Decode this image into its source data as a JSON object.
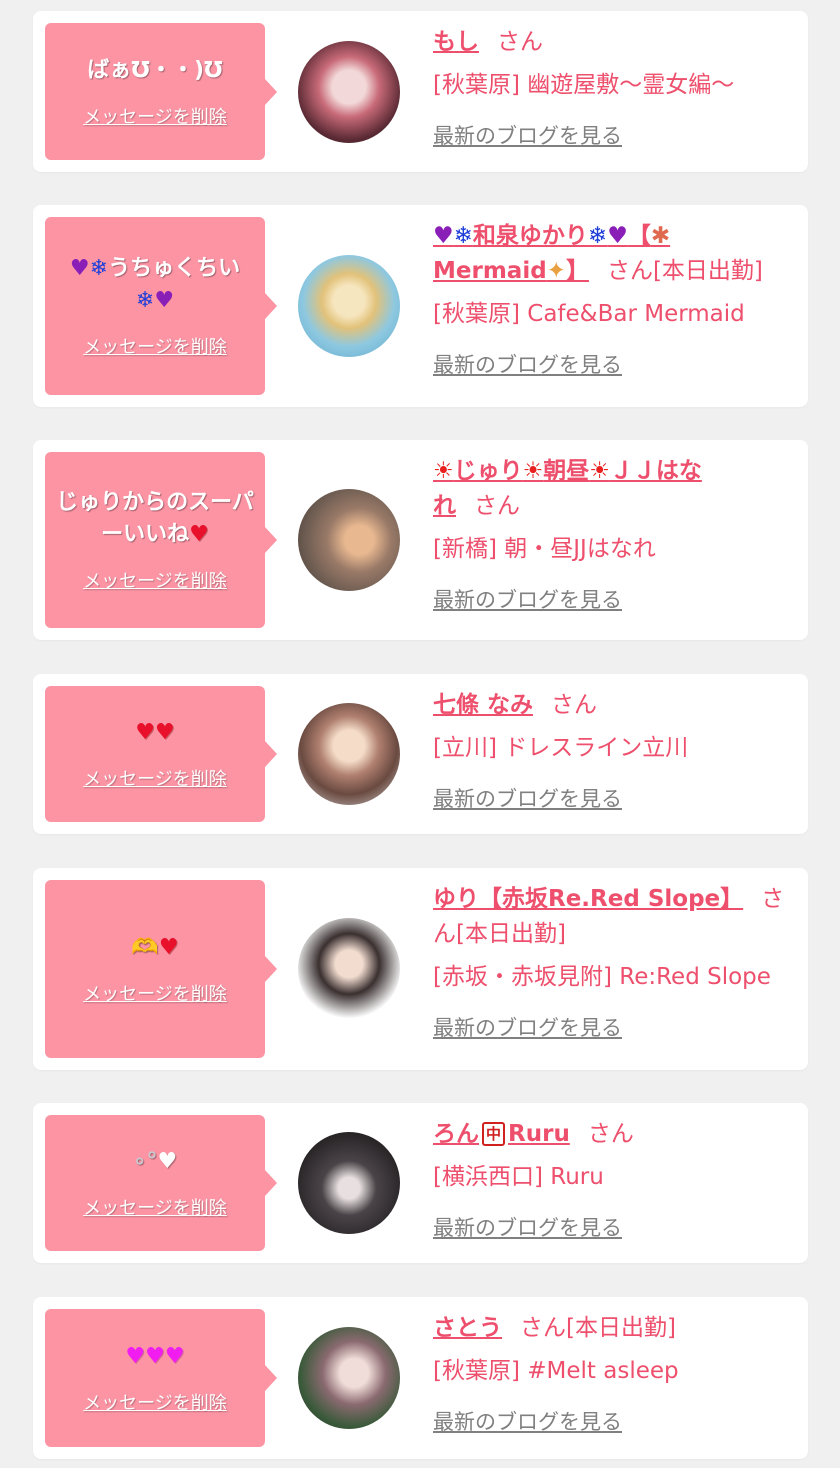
{
  "cards": [
    {
      "message": "ばぁ℧・・)℧",
      "delete_label": "メッセージを削除",
      "name": "もし",
      "honorific": "さん",
      "status": "",
      "shop": "[秋葉原] 幽遊屋敷〜霊女編〜",
      "blog_label": "最新のブログを見る"
    },
    {
      "message": "うちゅくちい",
      "delete_label": "メッセージを削除",
      "name": "和泉ゆかり",
      "name_suffix": "【",
      "name_line2": "Mermaid",
      "name_line2_suffix": "】",
      "honorific": "さん",
      "status": "[本日出勤]",
      "shop": "[秋葉原] Cafe&Bar Mermaid",
      "blog_label": "最新のブログを見る"
    },
    {
      "message": "じゅりからのスーパーいいね",
      "delete_label": "メッセージを削除",
      "name_parts": [
        "じゅり",
        "朝昼",
        "ＪＪはな"
      ],
      "name_line2": "れ",
      "honorific": "さん",
      "status": "",
      "shop": "[新橋] 朝・昼JJはなれ",
      "blog_label": "最新のブログを見る"
    },
    {
      "message": "",
      "delete_label": "メッセージを削除",
      "name": "七條 なみ",
      "honorific": "さん",
      "status": "",
      "shop": "[立川] ドレスライン立川",
      "blog_label": "最新のブログを見る"
    },
    {
      "message": "",
      "delete_label": "メッセージを削除",
      "name": "ゆり【赤坂Re.Red Slope】",
      "honorific": "さ",
      "honorific_line2": "ん",
      "status": "[本日出勤]",
      "shop": "[赤坂・赤坂見附] Re:Red Slope",
      "blog_label": "最新のブログを見る"
    },
    {
      "message": "",
      "delete_label": "メッセージを削除",
      "name_parts": [
        "ろん",
        "Ruru"
      ],
      "honorific": "さん",
      "status": "",
      "shop": "[横浜西口] Ruru",
      "blog_label": "最新のブログを見る"
    },
    {
      "message": "",
      "delete_label": "メッセージを削除",
      "name": "さとう",
      "honorific": "さん",
      "status": "[本日出勤]",
      "shop": "[秋葉原] #Melt asleep",
      "blog_label": "最新のブログを見る"
    }
  ],
  "colors": {
    "page_bg": "#f1f0f0",
    "bubble": "#fc94a4",
    "accent_pink": "#ed4f6c",
    "link_grey": "#808080"
  },
  "icons": [
    "purple-heart-icon",
    "snowflake-icon",
    "coral-icon",
    "mermaid-icon",
    "sun-icon",
    "red-heart-icon",
    "heart-hands-icon",
    "bubbles-icon",
    "white-heart-icon",
    "mahjong-tile-icon",
    "magenta-heart-icon"
  ]
}
